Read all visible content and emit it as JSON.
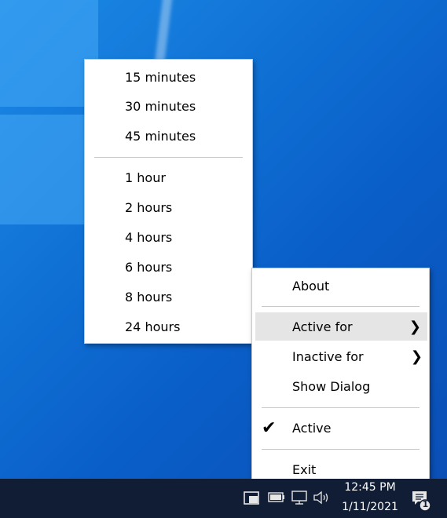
{
  "submenu": {
    "items": [
      "15 minutes",
      "30 minutes",
      "45 minutes",
      "1 hour",
      "2 hours",
      "4 hours",
      "6 hours",
      "8 hours",
      "24 hours"
    ]
  },
  "context_menu": {
    "about": "About",
    "active_for": "Active for",
    "inactive_for": "Inactive for",
    "show_dialog": "Show Dialog",
    "active": "Active",
    "exit": "Exit"
  },
  "taskbar": {
    "time": "12:45 PM",
    "date": "1/11/2021",
    "notification_count": "1"
  },
  "icons": {
    "submenu_arrow": "chevron-right-icon",
    "checkmark": "checkmark-icon",
    "tray": [
      "app-tray-icon",
      "battery-icon",
      "network-icon",
      "volume-icon",
      "notification-icon"
    ]
  },
  "colors": {
    "desktop_blue": "#0f6fd3",
    "taskbar": "#111d35",
    "menu_highlight": "#e5e5e5"
  }
}
